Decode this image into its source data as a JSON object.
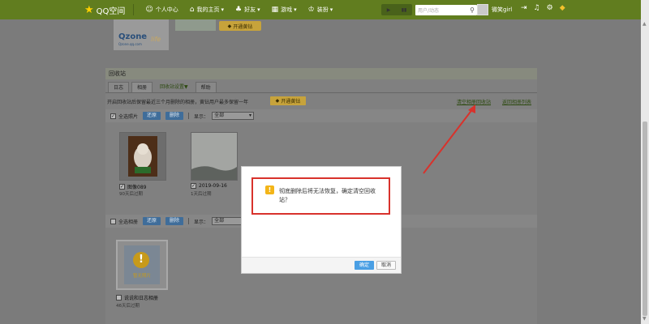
{
  "topnav": {
    "brand": "QQ空间",
    "items": [
      {
        "label": "个人中心",
        "icon": "user-icon"
      },
      {
        "label": "我的主页",
        "icon": "home-icon"
      },
      {
        "label": "好友",
        "icon": "friends-icon"
      },
      {
        "label": "游戏",
        "icon": "game-icon"
      },
      {
        "label": "装扮",
        "icon": "shirt-icon"
      }
    ],
    "search_placeholder": "用户/动态",
    "username": "微笑girl"
  },
  "header": {
    "logo": "Qzone",
    "logo_sub": "Qzone.qq.com",
    "logo_script": "life",
    "vip_button": "开通黄钻"
  },
  "recycle": {
    "title": "回收站",
    "tabs": [
      "日志",
      "相册",
      "回收站设置▼",
      "帮助"
    ],
    "description": "开启回收站后保留最近三个月删除的相册，黄钻用户最多保留一年",
    "vip_button": "开通黄钻",
    "link_clear": "清空相册回收站",
    "link_back": "返回相册列表",
    "bar1": {
      "select_all": "全选照片",
      "restore": "还原",
      "delete": "删除",
      "show_label": "显示：",
      "show_value": "全部"
    },
    "bar2": {
      "select_all": "全选相册",
      "restore": "还原",
      "delete": "删除",
      "show_label": "显示：",
      "show_value": "全部"
    },
    "photos": [
      {
        "name": "图像089",
        "expire": "90天后过期"
      },
      {
        "name": "2019-09-16",
        "expire": "1天后过期"
      }
    ],
    "album": {
      "cover_text": "暂无照片",
      "name": "说说和日志相册",
      "expire": "46天后过期"
    }
  },
  "modal": {
    "message": "彻底删除后将无法恢复，确定清空回收站？",
    "ok": "确定",
    "cancel": "取消"
  },
  "colors": {
    "nav": "#617d1f",
    "highlight": "#d8322c",
    "ok": "#4a9fe4",
    "vip": "#f3c12c"
  }
}
